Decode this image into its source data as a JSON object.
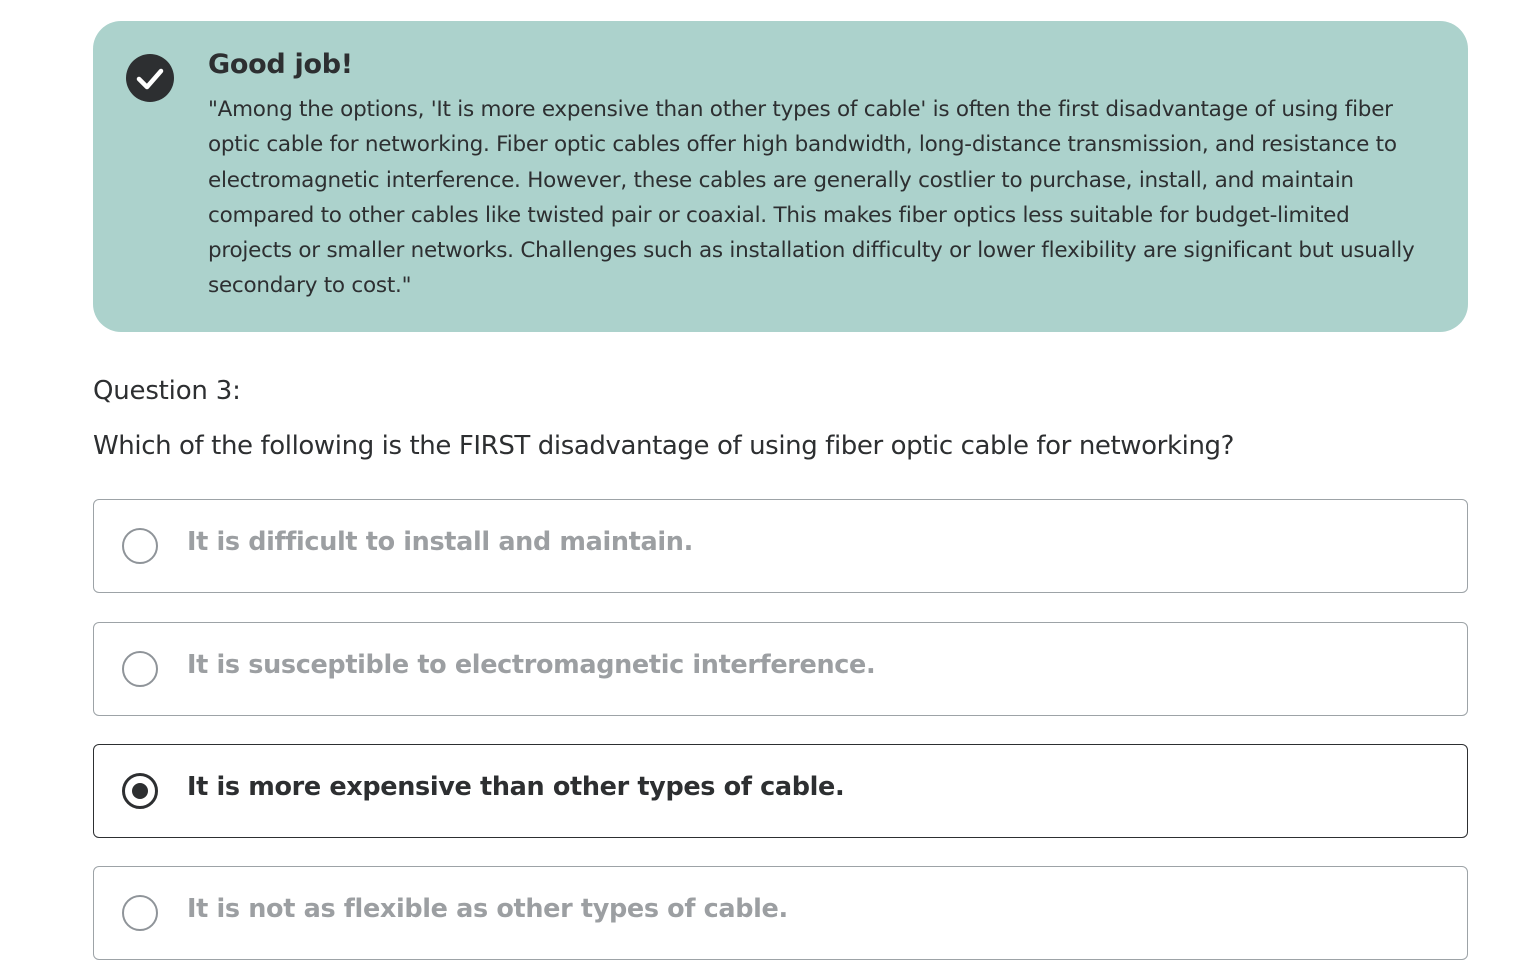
{
  "feedback": {
    "title": "Good job!",
    "body": "\"Among the options, 'It is more expensive than other types of cable' is often the first disadvantage of using fiber optic cable for networking. Fiber optic cables offer high bandwidth, long-distance transmission, and resistance to electromagnetic interference. However, these cables are generally costlier to purchase, install, and maintain compared to other cables like twisted pair or coaxial. This makes fiber optics less suitable for budget-limited projects or smaller networks. Challenges such as installation difficulty or lower flexibility are significant but usually secondary to cost.\"",
    "icon": "check-circle-icon",
    "background_color": "#acd2cc"
  },
  "question": {
    "number_label": "Question 3:",
    "text": "Which of the following is the FIRST disadvantage of using fiber optic cable for networking?"
  },
  "options": [
    {
      "label": "It is difficult to install and maintain.",
      "selected": false
    },
    {
      "label": "It is susceptible to electromagnetic interference.",
      "selected": false
    },
    {
      "label": "It is more expensive than other types of cable.",
      "selected": true
    },
    {
      "label": "It is not as flexible as other types of cable.",
      "selected": false
    }
  ]
}
